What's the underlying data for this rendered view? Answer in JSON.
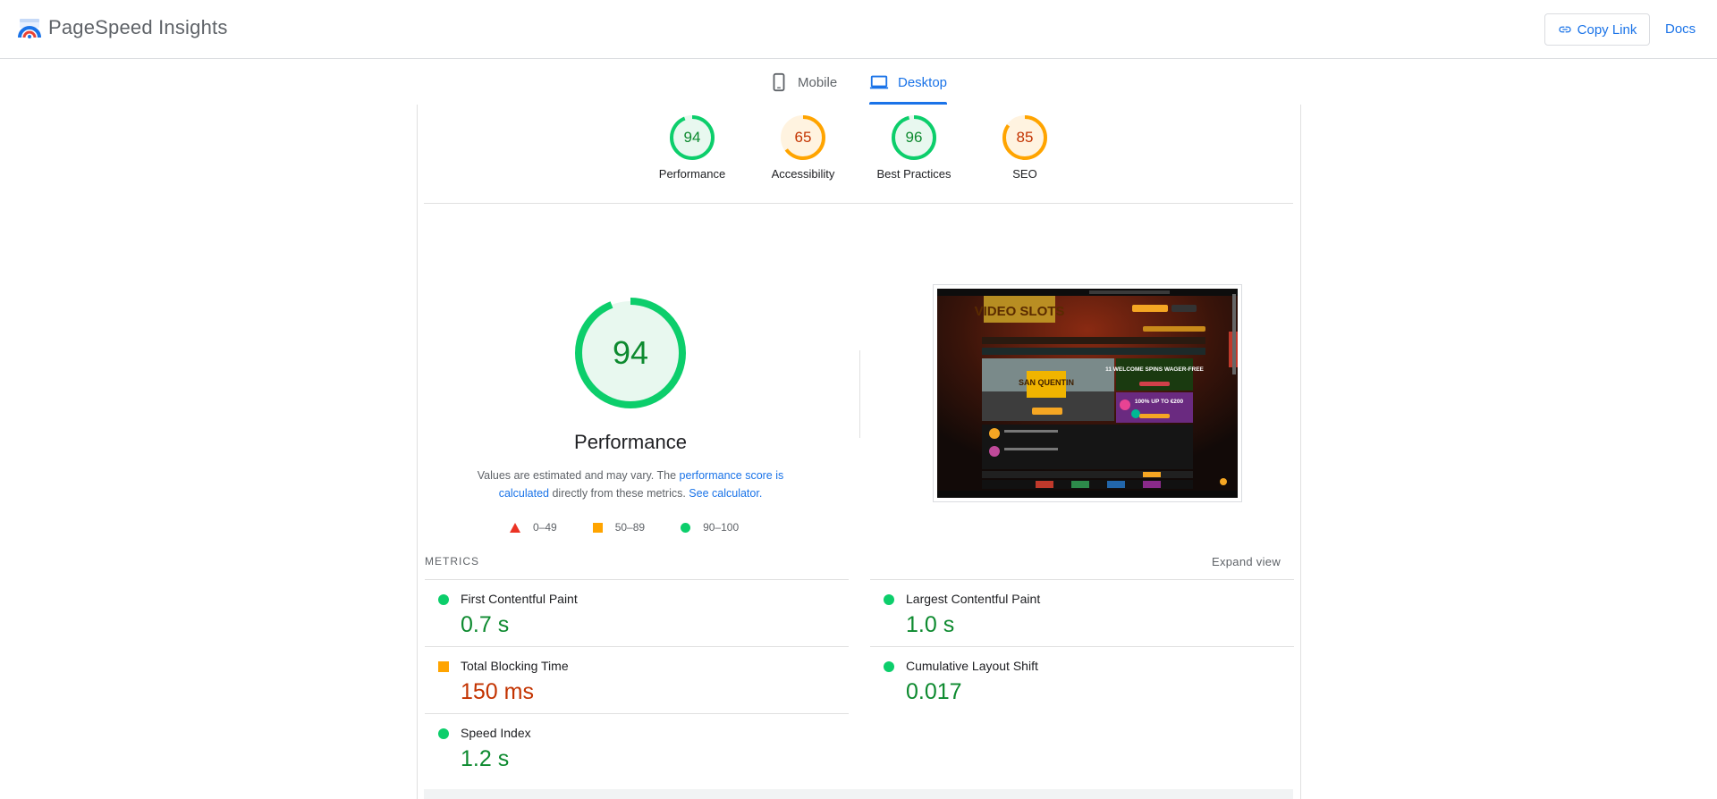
{
  "header": {
    "app_title": "PageSpeed Insights",
    "copy_link_label": "Copy Link",
    "docs_label": "Docs"
  },
  "tabs": [
    {
      "label": "Mobile",
      "icon": "smartphone-icon",
      "active": false
    },
    {
      "label": "Desktop",
      "icon": "laptop-icon",
      "active": true
    }
  ],
  "categories": [
    {
      "score": "94",
      "label": "Performance",
      "value": 94,
      "color": "#0cce6b",
      "text_color": "#0d8a2f"
    },
    {
      "score": "65",
      "label": "Accessibility",
      "value": 65,
      "color": "#ffa400",
      "text_color": "#c33300"
    },
    {
      "score": "96",
      "label": "Best Practices",
      "value": 96,
      "color": "#0cce6b",
      "text_color": "#0d8a2f"
    },
    {
      "score": "85",
      "label": "SEO",
      "value": 85,
      "color": "#ffa400",
      "text_color": "#c33300"
    }
  ],
  "performance": {
    "score": "94",
    "value": 94,
    "title": "Performance",
    "note_prefix": "Values are estimated and may vary. The ",
    "note_link1": "performance score is calculated",
    "note_middle": " directly from these metrics. ",
    "note_link2": "See calculator."
  },
  "legend": [
    {
      "shape": "triangle",
      "label": "0–49",
      "color": "#eb3324"
    },
    {
      "shape": "square",
      "label": "50–89",
      "color": "#ffa400"
    },
    {
      "shape": "circle",
      "label": "90–100",
      "color": "#0cce6b"
    }
  ],
  "metrics": {
    "heading": "METRICS",
    "expand_label": "Expand view",
    "items": [
      {
        "name": "First Contentful Paint",
        "value": "0.7 s",
        "status": "good"
      },
      {
        "name": "Largest Contentful Paint",
        "value": "1.0 s",
        "status": "good"
      },
      {
        "name": "Total Blocking Time",
        "value": "150 ms",
        "status": "average"
      },
      {
        "name": "Cumulative Layout Shift",
        "value": "0.017",
        "status": "good"
      },
      {
        "name": "Speed Index",
        "value": "1.2 s",
        "status": "good"
      }
    ]
  },
  "thumbnail": {
    "logo_text": "VIDEO SLOTS",
    "promo1": "11 WELCOME SPINS WAGER-FREE",
    "promo2": "100% UP TO €200",
    "hero_text": "SAN QUENTIN"
  }
}
